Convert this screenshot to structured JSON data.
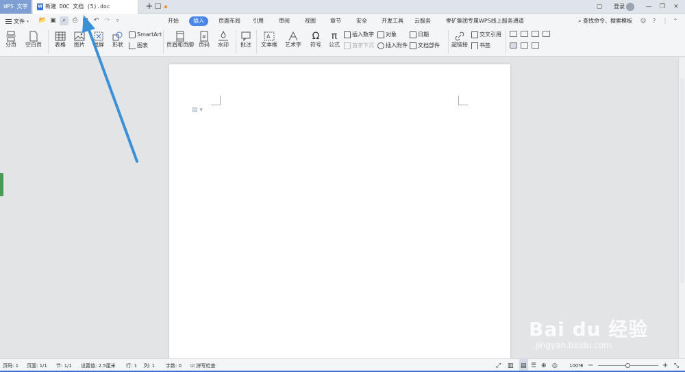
{
  "titlebar": {
    "app_tab": "WPS 文字",
    "doc_title": "新建 DOC 文档 (5).doc",
    "new_tab": "+",
    "login": "登录"
  },
  "quick_access": {
    "file_label": "文件"
  },
  "ribbon_tabs": [
    "开始",
    "插入",
    "页面布局",
    "引用",
    "审阅",
    "视图",
    "章节",
    "安全",
    "开发工具",
    "云服务",
    "枣矿集团专属WPS线上服务通道"
  ],
  "active_tab": "插入",
  "search_label": "查找命令、搜索模板",
  "tools": {
    "page_break": "分页",
    "blank_page": "空白页",
    "table": "表格",
    "picture": "图片",
    "screenshot": "截屏",
    "shape": "形状",
    "smartart": "SmartArt",
    "chart": "图表",
    "header_footer": "页眉和页脚",
    "page_number": "页码",
    "watermark": "水印",
    "comment": "批注",
    "textbox": "文本框",
    "wordart": "艺术字",
    "symbol": "符号",
    "formula": "公式",
    "insert_number": "插入数字",
    "first_letter": "首字下沉",
    "object": "对象",
    "attach": "插入附件",
    "date": "日期",
    "doc_parts": "文档部件",
    "hyperlink": "超链接",
    "cross_ref": "交叉引用",
    "bookmark": "书签"
  },
  "statusbar": {
    "page_code": "页码: 1",
    "page": "页面: 1/1",
    "section": "节: 1/1",
    "setting": "设置值: 2.5厘米",
    "row": "行: 1",
    "col": "列: 1",
    "words": "字数: 0",
    "spell": "拼写检查",
    "zoom": "100%"
  },
  "watermark": {
    "logo": "Bai du 经验",
    "url": "jingyan.baidu.com"
  },
  "colors": {
    "accent": "#4a86e8",
    "arrow": "#3a8fd6",
    "app_tab": "#7f9fd3"
  }
}
